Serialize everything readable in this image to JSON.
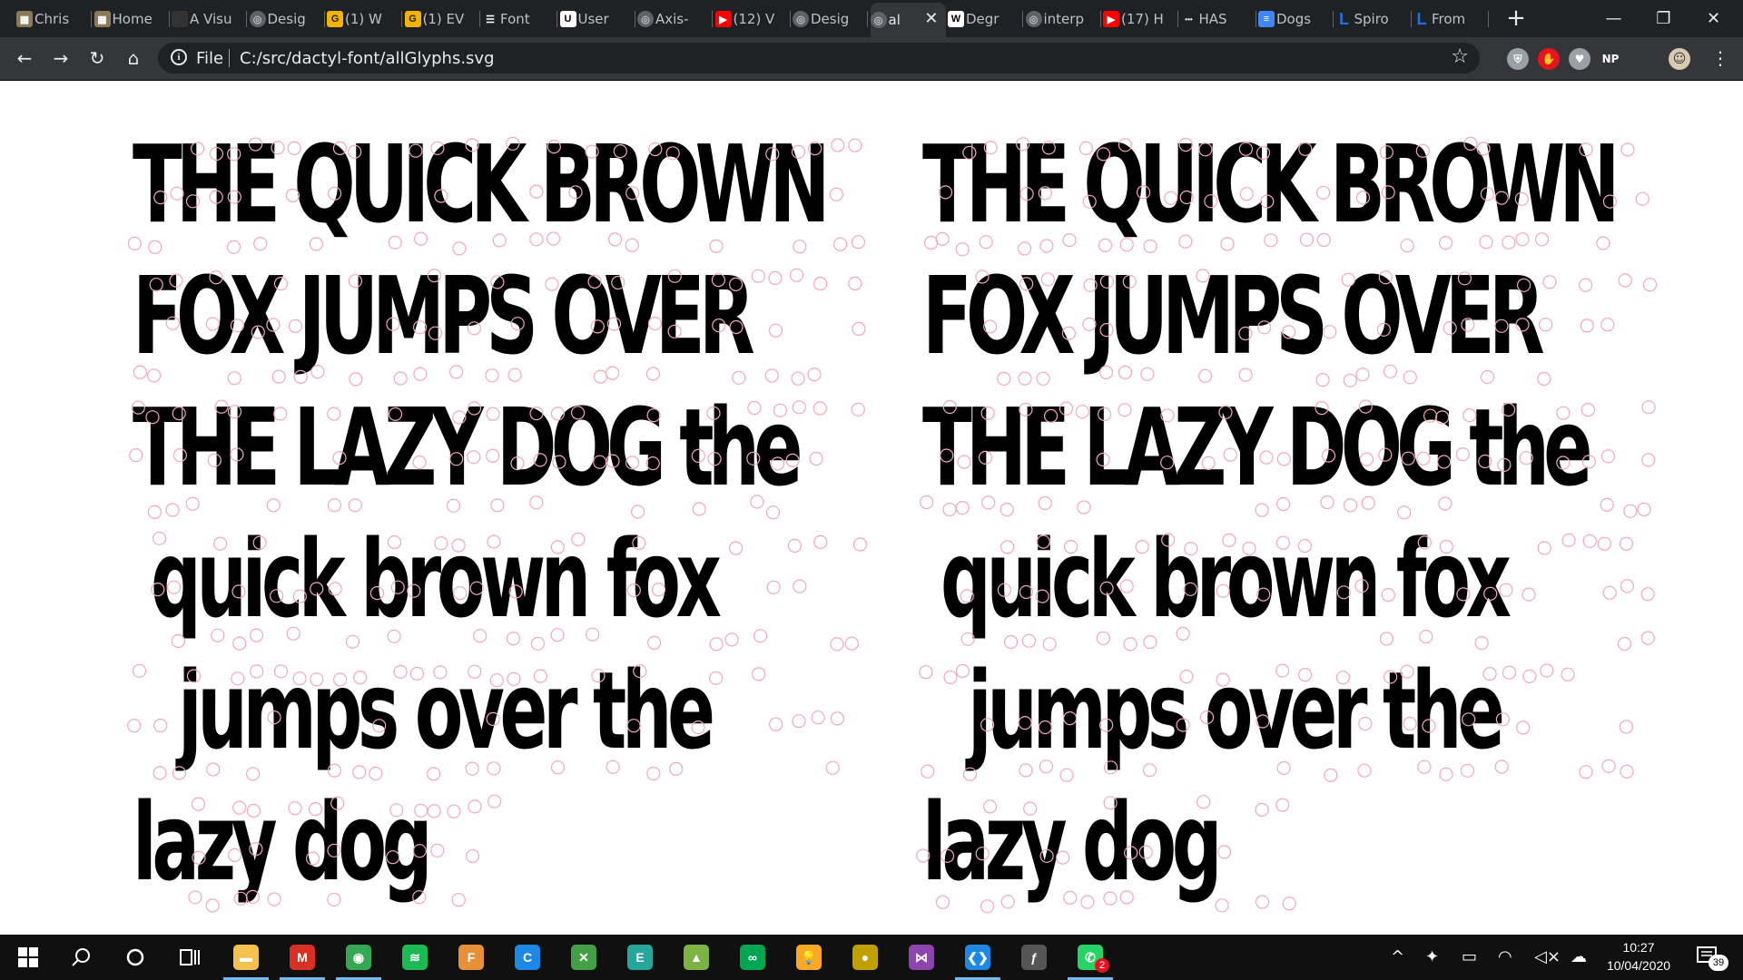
{
  "browser": {
    "tabs": [
      {
        "label": "Chris",
        "icon": "picture-icon",
        "color": "#8a7a5a"
      },
      {
        "label": "Home",
        "icon": "picture-icon",
        "color": "#8a7a5a"
      },
      {
        "label": "A Visu",
        "icon": "dark-logo-icon",
        "color": "#333333"
      },
      {
        "label": "Desig",
        "icon": "globe-icon",
        "color": "#5f6368"
      },
      {
        "label": "(1) W",
        "icon": "g-logo-icon",
        "color": "#f2b400"
      },
      {
        "label": "(1) EV",
        "icon": "g-logo-icon",
        "color": "#f2b400"
      },
      {
        "label": "Font",
        "icon": "sliders-icon",
        "color": "#5f6368"
      },
      {
        "label": "User",
        "icon": "u-logo-icon",
        "color": "#ffffff"
      },
      {
        "label": "Axis-",
        "icon": "globe-icon",
        "color": "#5f6368"
      },
      {
        "label": "(12) V",
        "icon": "youtube-icon",
        "color": "#ff0000"
      },
      {
        "label": "Desig",
        "icon": "globe-icon",
        "color": "#5f6368"
      },
      {
        "label": "al",
        "icon": "globe-icon",
        "color": "#5f6368",
        "active": true
      },
      {
        "label": "Degr",
        "icon": "wikipedia-icon",
        "color": "#ffffff"
      },
      {
        "label": "interp",
        "icon": "globe-icon",
        "color": "#5f6368"
      },
      {
        "label": "(17) H",
        "icon": "youtube-icon",
        "color": "#ff0000"
      },
      {
        "label": "HAS",
        "icon": "dots-icon",
        "color": "#5f6368"
      },
      {
        "label": "Dogs",
        "icon": "docs-icon",
        "color": "#4285f4"
      },
      {
        "label": "Spiro",
        "icon": "l-logo-icon",
        "color": "#1a73e8"
      },
      {
        "label": "From",
        "icon": "l-logo-icon",
        "color": "#1a73e8"
      }
    ],
    "new_tab_glyph": "+",
    "window_controls": {
      "minimize": "—",
      "restore": "❐",
      "close": "✕"
    },
    "toolbar": {
      "back_glyph": "←",
      "forward_glyph": "→",
      "reload_glyph": "↻",
      "home_glyph": "⌂",
      "scheme": "File",
      "url": "C:/src/dactyl-font/allGlyphs.svg",
      "star_glyph": "☆",
      "extensions": [
        {
          "name": "shield-extension-icon",
          "color": "#9aa0a6",
          "text": "⛨"
        },
        {
          "name": "hand-extension-icon",
          "color": "#e8141c",
          "text": "✋"
        },
        {
          "name": "heart-extension-icon",
          "color": "#9aa0a6",
          "text": "♥"
        },
        {
          "name": "np-extension-icon",
          "color": "#35363a",
          "text": "NP"
        }
      ],
      "menu_glyph": "⋮"
    }
  },
  "page": {
    "lines": [
      "THE QUICK BROWN",
      "FOX JUMPS OVER",
      "THE LAZY DOG the",
      "quick brown fox",
      "jumps over the",
      "lazy dog"
    ]
  },
  "taskbar": {
    "apps": [
      {
        "name": "file-explorer-icon",
        "color": "#f2c14e",
        "text": "▬",
        "running": true
      },
      {
        "name": "gmail-icon",
        "color": "#d93025",
        "text": "M",
        "running": true
      },
      {
        "name": "chrome-icon",
        "color": "#34a853",
        "text": "◉",
        "running": true
      },
      {
        "name": "spotify-icon",
        "color": "#1db954",
        "text": "≋",
        "running": false
      },
      {
        "name": "fontforge-icon",
        "color": "#e69138",
        "text": "F",
        "running": false
      },
      {
        "name": "c-app-icon",
        "color": "#1e88e5",
        "text": "C",
        "running": false
      },
      {
        "name": "x-app-icon",
        "color": "#43a047",
        "text": "✕",
        "running": false
      },
      {
        "name": "terminal-icon",
        "color": "#26a69a",
        "text": "E",
        "running": false
      },
      {
        "name": "image-app-icon",
        "color": "#7cb342",
        "text": "▲",
        "running": false
      },
      {
        "name": "infinity-app-icon",
        "color": "#00a651",
        "text": "∞",
        "running": false
      },
      {
        "name": "bulb-app-icon",
        "color": "#f9a825",
        "text": "💡",
        "running": false
      },
      {
        "name": "ball-app-icon",
        "color": "#c0a000",
        "text": "●",
        "running": false
      },
      {
        "name": "visual-studio-icon",
        "color": "#8e44ad",
        "text": "⋈",
        "running": false
      },
      {
        "name": "vscode-icon",
        "color": "#1e88e5",
        "text": "❮❯",
        "running": true
      },
      {
        "name": "script-app-icon",
        "color": "#555555",
        "text": "ƒ",
        "running": false
      },
      {
        "name": "whatsapp-icon",
        "color": "#25d366",
        "text": "✆",
        "running": true,
        "badge": "2"
      }
    ],
    "tray": {
      "chevron": "^",
      "time": "10:27",
      "date": "10/04/2020",
      "notifications": "39"
    }
  }
}
